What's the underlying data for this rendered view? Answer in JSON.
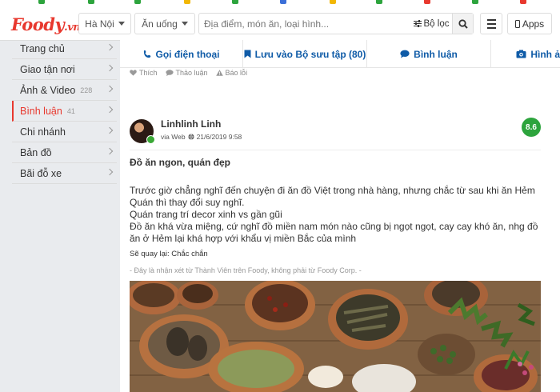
{
  "header": {
    "logo_text": "Foody",
    "logo_suffix": ".vn",
    "logo_mark": "®",
    "city": "Hà Nội",
    "category": "Ăn uống",
    "search_placeholder": "Địa điểm, món ăn, loại hình...",
    "filter_label": "Bộ lọc",
    "apps_label": "Apps",
    "brand_color": "#e8382e"
  },
  "sidebar": {
    "items": [
      {
        "label": "Trang chủ",
        "count": ""
      },
      {
        "label": "Giao tận nơi",
        "count": ""
      },
      {
        "label": "Ảnh & Video",
        "count": "228"
      },
      {
        "label": "Bình luận",
        "count": "41",
        "active": true
      },
      {
        "label": "Chi nhánh",
        "count": ""
      },
      {
        "label": "Bản đồ",
        "count": ""
      },
      {
        "label": "Bãi đỗ xe",
        "count": ""
      }
    ]
  },
  "actions": {
    "call": "Gọi điện thoại",
    "save": "Lưu vào Bộ sưu tập (80)",
    "comment": "Bình luận",
    "photo": "Hình ả"
  },
  "reactions": {
    "like": "Thích",
    "discuss": "Thảo luận",
    "report": "Báo lỗi"
  },
  "review": {
    "user": "Linhlinh Linh",
    "via": "via Web",
    "date": "21/6/2019 9:58",
    "score": "8.6",
    "title": "Đồ ăn ngon, quán đẹp",
    "body_lines": [
      "Trước giờ chẳng nghĩ đến chuyện đi ăn đồ Việt trong nhà hàng, nhưng chắc từ sau khi ăn Hẻm Quán thì thay đổi suy nghĩ.",
      "Quán trang trí decor xinh vs gần gũi",
      "Đồ ăn khá vừa miệng, cứ nghĩ đồ miền nam món nào cũng bị ngọt ngọt, cay cay khó ăn, nhg đồ ăn ở Hẻm lại khá hợp với khẩu vị miền Bắc của mình"
    ],
    "revisit": "Sẽ quay lại: Chắc chắn",
    "disclaimer": "- Đây là nhận xét từ Thành Viên trên Foody, không phải từ Foody Corp. -",
    "score_color": "#2da43d"
  }
}
